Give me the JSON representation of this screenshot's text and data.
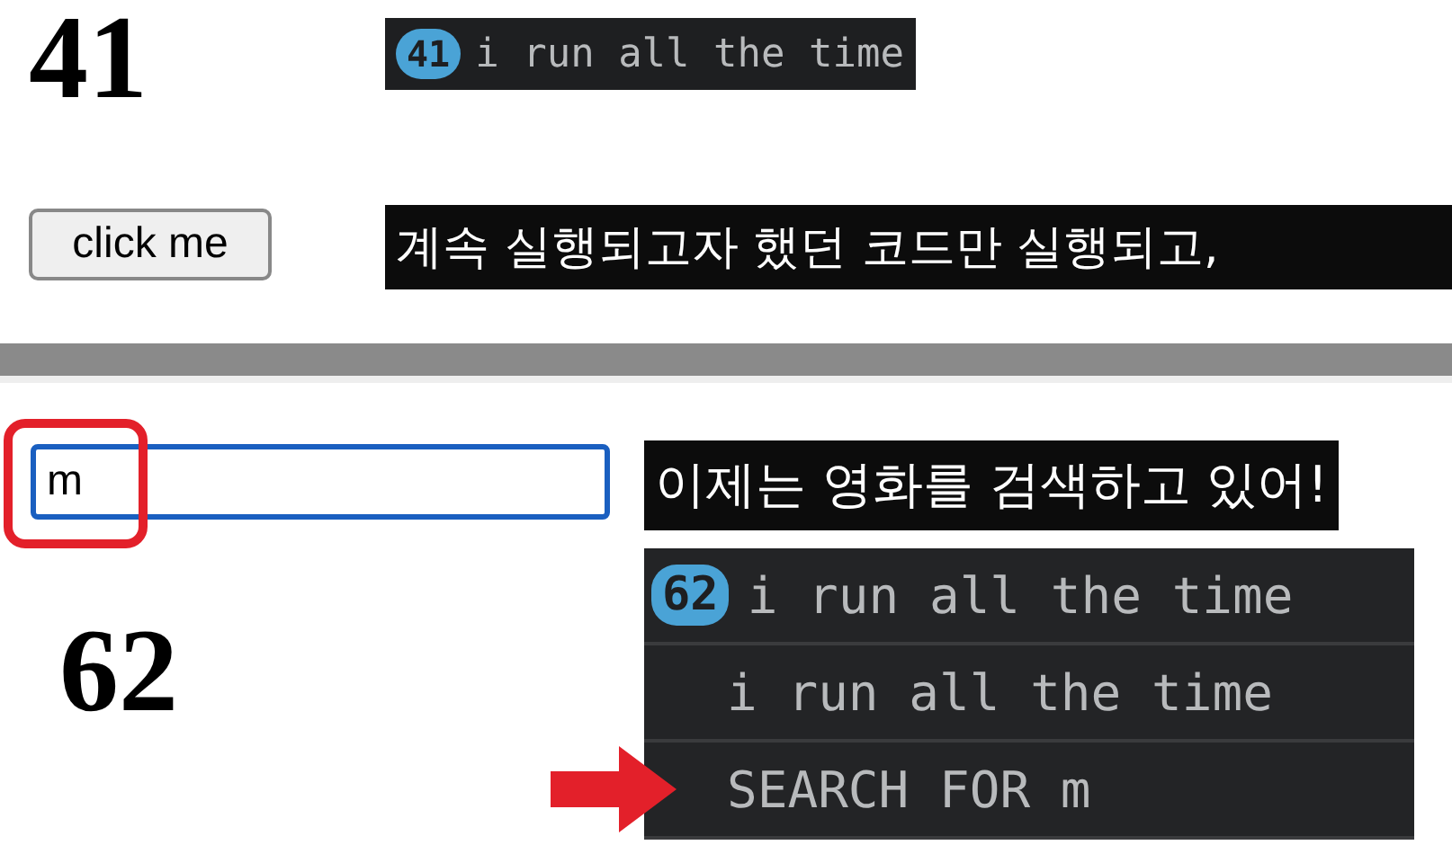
{
  "top": {
    "counter": "41",
    "console": {
      "count": "41",
      "message": "i run all the time"
    },
    "button": "click me",
    "subtitle": "계속 실행되고자 했던 코드만 실행되고,"
  },
  "bottom": {
    "search": {
      "value": "m",
      "highlighted": true
    },
    "subtitle": "이제는 영화를 검색하고 있어!",
    "counter": "62",
    "console": [
      {
        "count": "62",
        "message": "i run all the time",
        "pointed": false
      },
      {
        "message": "i run all the time",
        "pointed": false
      },
      {
        "message": "SEARCH FOR m",
        "pointed": true
      }
    ]
  }
}
